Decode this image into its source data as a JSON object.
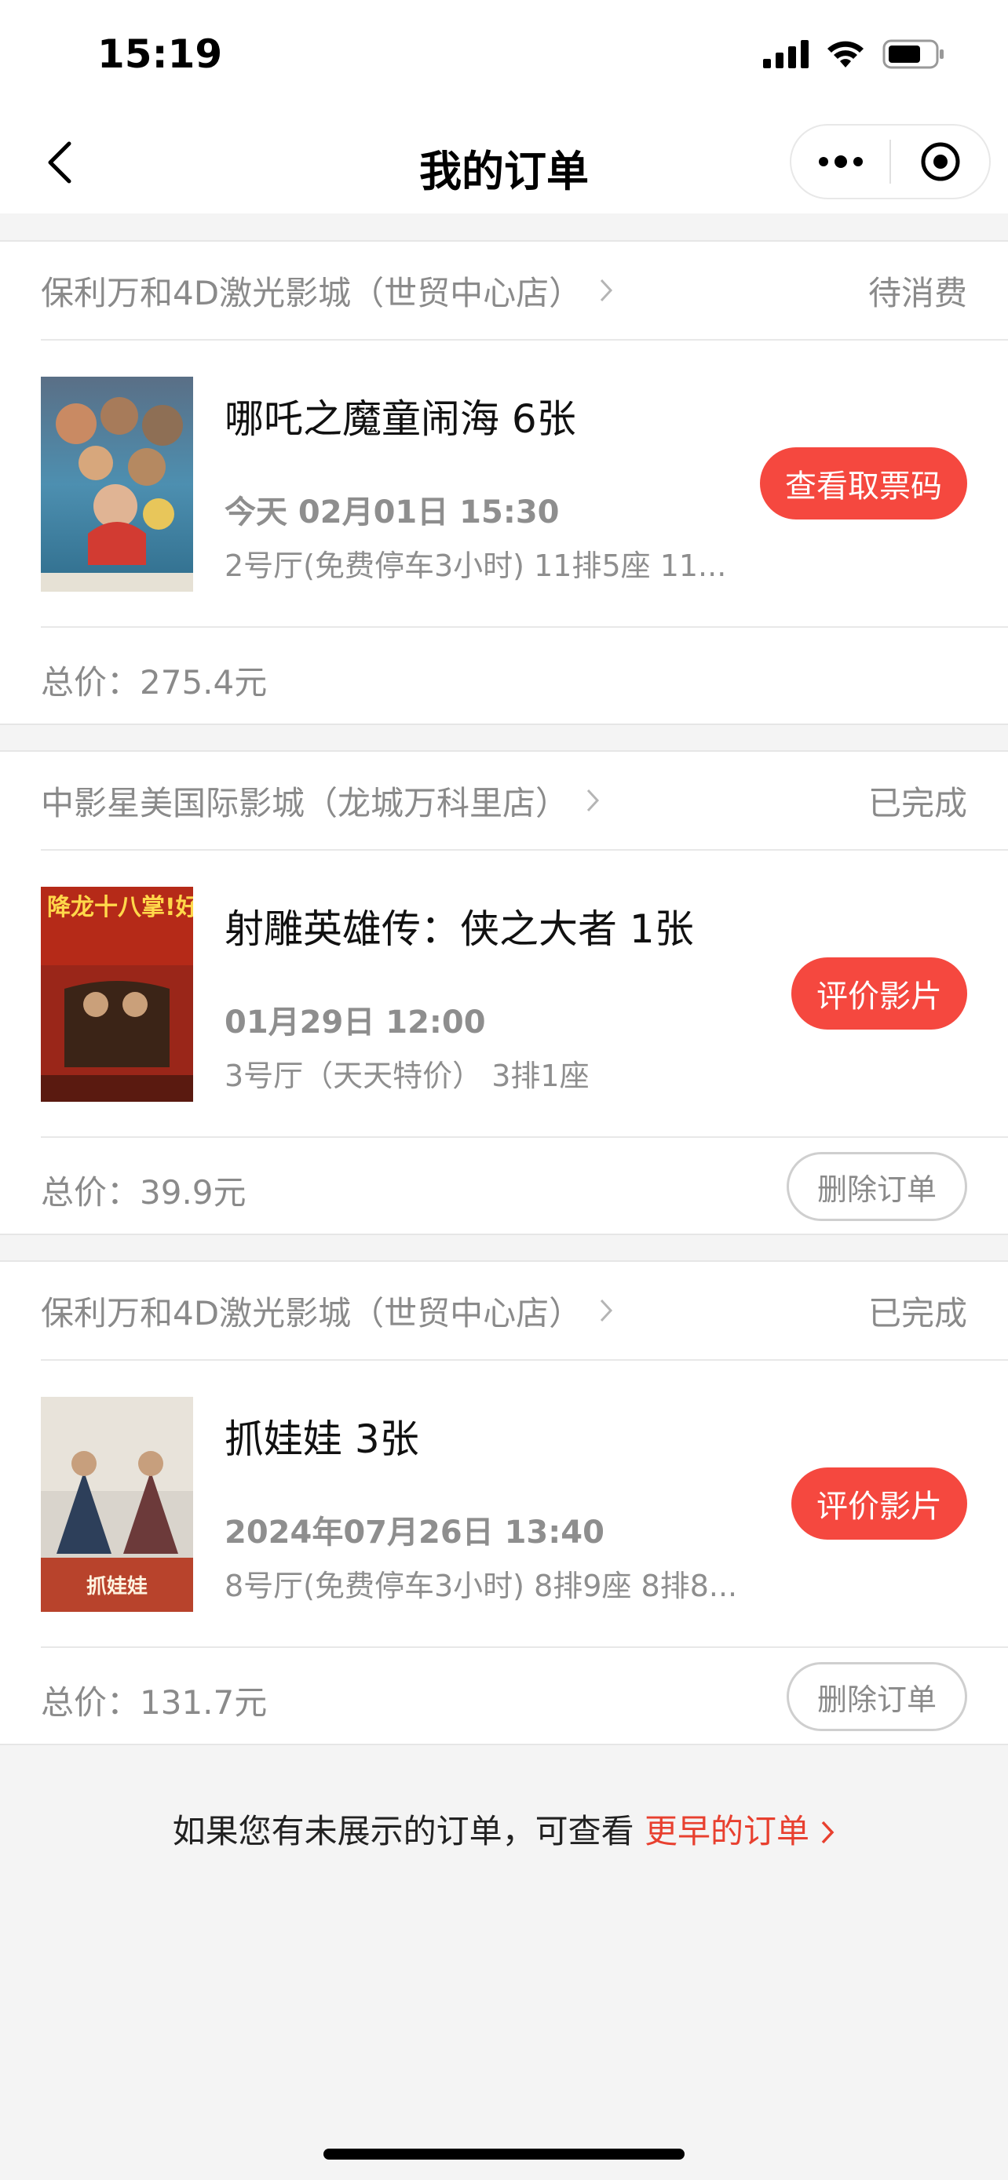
{
  "status_bar": {
    "time": "15:19"
  },
  "nav": {
    "title": "我的订单"
  },
  "orders": [
    {
      "cinema": "保利万和4D激光影城（世贸中心店）",
      "status": "待消费",
      "movie": "哪吒之魔童闹海 6张",
      "time": "今天 02月01日 15:30",
      "hall": "2号厅(免费停车3小时) 11排5座 11...",
      "action": "查看取票码",
      "total_label": "总价：",
      "total": "275.4元",
      "poster_icon": "nezha-poster-image"
    },
    {
      "cinema": "中影星美国际影城（龙城万科里店）",
      "status": "已完成",
      "movie": "射雕英雄传：侠之大者 1张",
      "time": "01月29日 12:00",
      "hall": "3号厅（天天特价） 3排1座",
      "action": "评价影片",
      "total_label": "总价：",
      "total": "39.9元",
      "delete": "删除订单",
      "poster_icon": "shediao-poster-image",
      "poster_text": "降龙十八掌!好运涨涨涨"
    },
    {
      "cinema": "保利万和4D激光影城（世贸中心店）",
      "status": "已完成",
      "movie": "抓娃娃 3张",
      "time": "2024年07月26日 13:40",
      "hall": "8号厅(免费停车3小时) 8排9座 8排8...",
      "action": "评价影片",
      "total_label": "总价：",
      "total": "131.7元",
      "delete": "删除订单",
      "poster_icon": "zhuawawa-poster-image",
      "poster_text": "抓娃娃"
    }
  ],
  "footer": {
    "text": "如果您有未展示的订单，可查看 ",
    "link": "更早的订单"
  },
  "colors": {
    "accent": "#f5483f",
    "muted_text": "#8a8a8a",
    "background": "#f4f4f4"
  }
}
